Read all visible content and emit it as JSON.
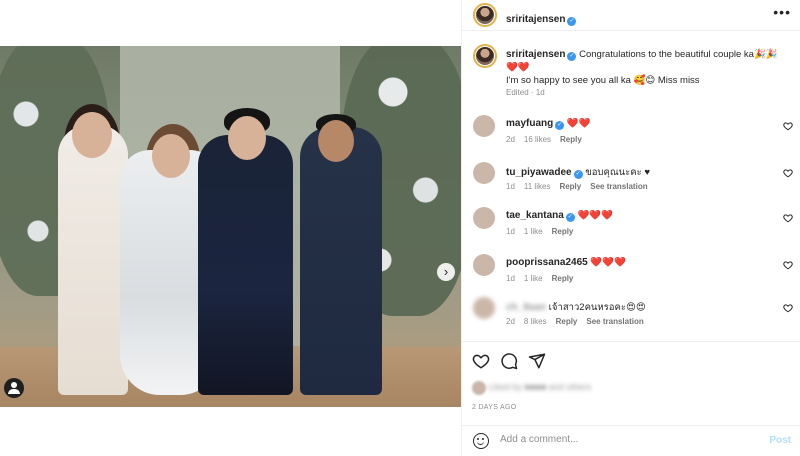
{
  "post": {
    "author": "sriritajensen",
    "caption_line1": "Congratulations to the beautiful couple ka🎉🎉",
    "caption_hearts": "❤️❤️",
    "caption_line2": "I'm so happy to see you all ka 🥰😊 Miss miss",
    "caption_meta": "Edited · 1d",
    "more": "•••",
    "next_arrow": "›",
    "carousel_dots": 7,
    "active_dot": 1
  },
  "comments": [
    {
      "user": "mayfuang",
      "verified": true,
      "text": "❤️❤️",
      "age": "2d",
      "likes": "16 likes",
      "reply": "Reply",
      "translation": ""
    },
    {
      "user": "tu_piyawadee",
      "verified": true,
      "text": "ขอบคุณนะคะ ♥",
      "age": "1d",
      "likes": "11 likes",
      "reply": "Reply",
      "translation": "See translation"
    },
    {
      "user": "tae_kantana",
      "verified": true,
      "text": "❤️❤️❤️",
      "age": "1d",
      "likes": "1 like",
      "reply": "Reply",
      "translation": ""
    },
    {
      "user": "pooprissana2465",
      "verified": false,
      "text": "❤️❤️❤️",
      "age": "1d",
      "likes": "1 like",
      "reply": "Reply",
      "translation": ""
    },
    {
      "user": "ch_8aan",
      "verified": false,
      "text": "เจ้าสาว2คนหรอคะ😍😍",
      "age": "2d",
      "likes": "8 likes",
      "reply": "Reply",
      "translation": "See translation"
    }
  ],
  "footer": {
    "likes_text": "Liked by ■■■■ and others",
    "time_ago": "2 DAYS AGO",
    "comment_placeholder": "Add a comment...",
    "post_label": "Post"
  },
  "icons": {
    "like": "heart-outline-icon",
    "comment": "speech-bubble-icon",
    "share": "paper-plane-icon",
    "emoji": "smiley-icon"
  },
  "colors": {
    "verified": "#3897f0",
    "heart": "#e0245e",
    "post_disabled": "#b2dffc",
    "muted": "#8e8e8e"
  }
}
